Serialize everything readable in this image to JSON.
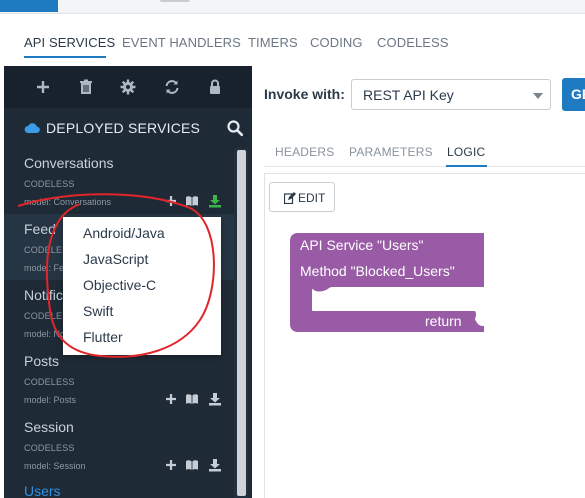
{
  "main_nav": {
    "items": [
      {
        "label": "API SERVICES",
        "active": true
      },
      {
        "label": "EVENT HANDLERS",
        "active": false
      },
      {
        "label": "TIMERS",
        "active": false
      },
      {
        "label": "CODING",
        "active": false
      },
      {
        "label": "CODELESS",
        "active": false
      }
    ]
  },
  "sidebar": {
    "toolbar_icons": [
      "plus-icon",
      "trash-icon",
      "gear-icon",
      "refresh-icon",
      "lock-icon"
    ],
    "section_title": "DEPLOYED SERVICES",
    "services": [
      {
        "name": "Conversations",
        "kind": "CODELESS",
        "model": "model: Conversations"
      },
      {
        "name": "Feed",
        "kind": "CODELESS",
        "model": "model: Feed"
      },
      {
        "name": "Notifications",
        "kind": "CODELESS",
        "model": "model: Notifications"
      },
      {
        "name": "Posts",
        "kind": "CODELESS",
        "model": "model: Posts"
      },
      {
        "name": "Session",
        "kind": "CODELESS",
        "model": "model: Session"
      },
      {
        "name": "Users"
      }
    ]
  },
  "invoke": {
    "label": "Invoke with:",
    "selected": "REST API Key",
    "button_label": "GE"
  },
  "sub_tabs": [
    {
      "label": "HEADERS",
      "active": false
    },
    {
      "label": "PARAMETERS",
      "active": false
    },
    {
      "label": "LOGIC",
      "active": true
    }
  ],
  "editor": {
    "edit_label": "EDIT",
    "block": {
      "line1": "API Service \"Users\"",
      "line2": "Method \"Blocked_Users\"",
      "return_label": "return"
    }
  },
  "download_menu": {
    "items": [
      "Android/Java",
      "JavaScript",
      "Objective-C",
      "Swift",
      "Flutter"
    ]
  },
  "colors": {
    "accent": "#1f7bc1",
    "sidebar_bg": "#1e2a36",
    "block_purple": "#9a5ba6",
    "annotation_red": "#e0262a",
    "download_green": "#3db34b"
  }
}
